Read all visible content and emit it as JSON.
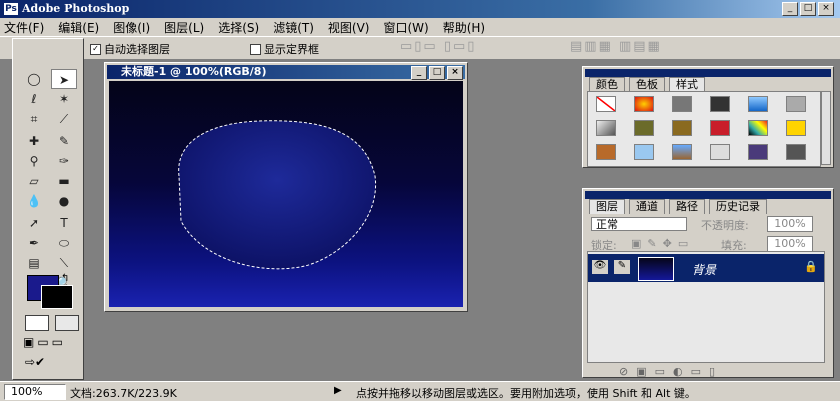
{
  "app": {
    "title": "Adobe Photoshop"
  },
  "menu": [
    "文件(F)",
    "编辑(E)",
    "图像(I)",
    "图层(L)",
    "选择(S)",
    "滤镜(T)",
    "视图(V)",
    "窗口(W)",
    "帮助(H)"
  ],
  "options": {
    "auto_select_layer": "自动选择图层",
    "show_bounding_box": "显示定界框"
  },
  "document": {
    "title": "未标题-1 @ 100%(RGB/8)"
  },
  "swatches_panel": {
    "tabs": [
      "颜色",
      "色板",
      "样式"
    ],
    "active_tab": "样式"
  },
  "layers_panel": {
    "tabs": [
      "图层",
      "通道",
      "路径",
      "历史记录"
    ],
    "blend_mode": "正常",
    "opacity_label": "不透明度:",
    "opacity_value": "100%",
    "lock_label": "锁定:",
    "fill_label": "填充:",
    "fill_value": "100%",
    "layer_name": "背景"
  },
  "status": {
    "zoom": "100%",
    "doc_size": "文档:263.7K/223.9K",
    "hint": "点按并拖移以移动图层或选区。要用附加选项，使用 Shift 和 Alt 键。"
  },
  "colors": {
    "foreground": "#1a1a8c",
    "background": "#000000",
    "selected_layer": "#0a246a"
  }
}
